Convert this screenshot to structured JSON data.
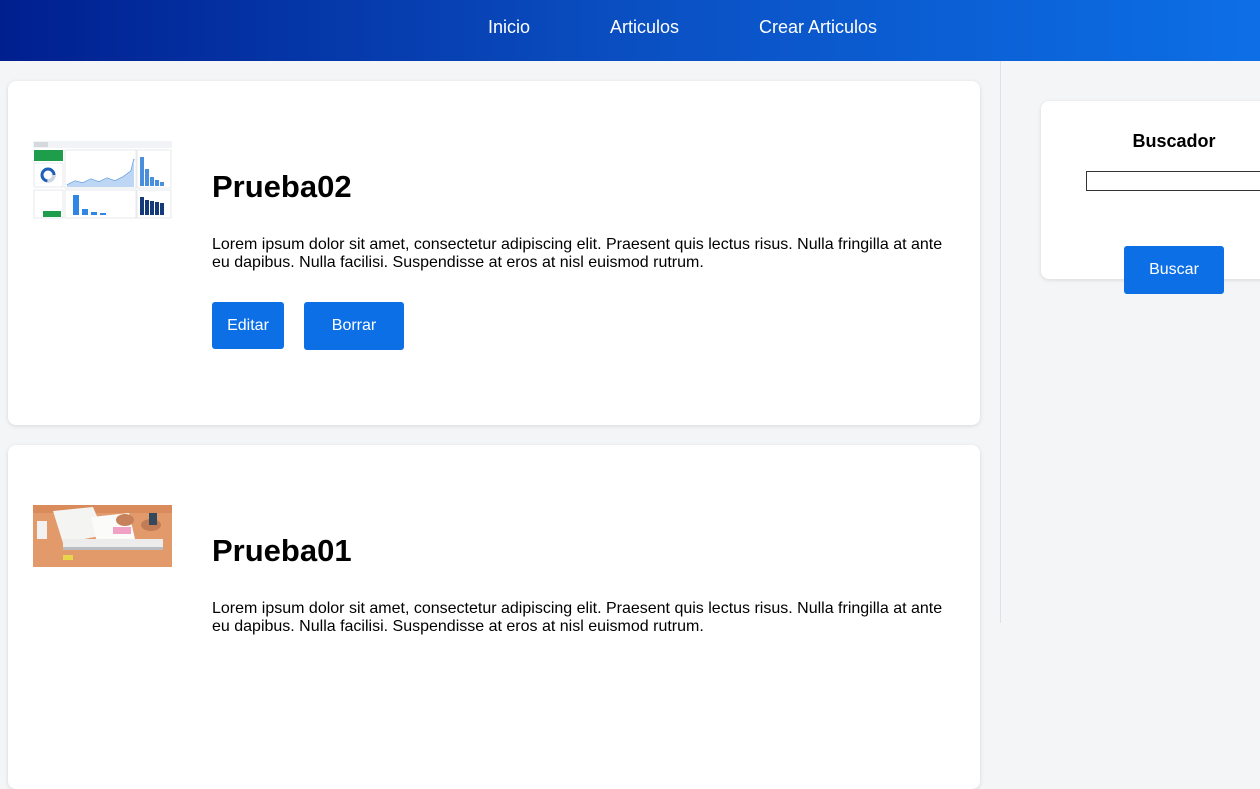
{
  "nav": {
    "items": [
      {
        "label": "Inicio"
      },
      {
        "label": "Articulos"
      },
      {
        "label": "Crear Articulos"
      }
    ]
  },
  "articles": [
    {
      "title": "Prueba02",
      "body": "Lorem ipsum dolor sit amet, consectetur adipiscing elit. Praesent quis lectus risus. Nulla fringilla at ante eu dapibus. Nulla facilisi. Suspendisse at eros at nisl euismod rutrum.",
      "edit_label": "Editar",
      "delete_label": "Borrar"
    },
    {
      "title": "Prueba01",
      "body": "Lorem ipsum dolor sit amet, consectetur adipiscing elit. Praesent quis lectus risus. Nulla fringilla at ante eu dapibus. Nulla facilisi. Suspendisse at eros at nisl euismod rutrum."
    }
  ],
  "search": {
    "title": "Buscador",
    "value": "",
    "button_label": "Buscar"
  },
  "colors": {
    "accent": "#0d6fe6",
    "nav_start": "#001f8f",
    "nav_end": "#0d6fe6"
  }
}
